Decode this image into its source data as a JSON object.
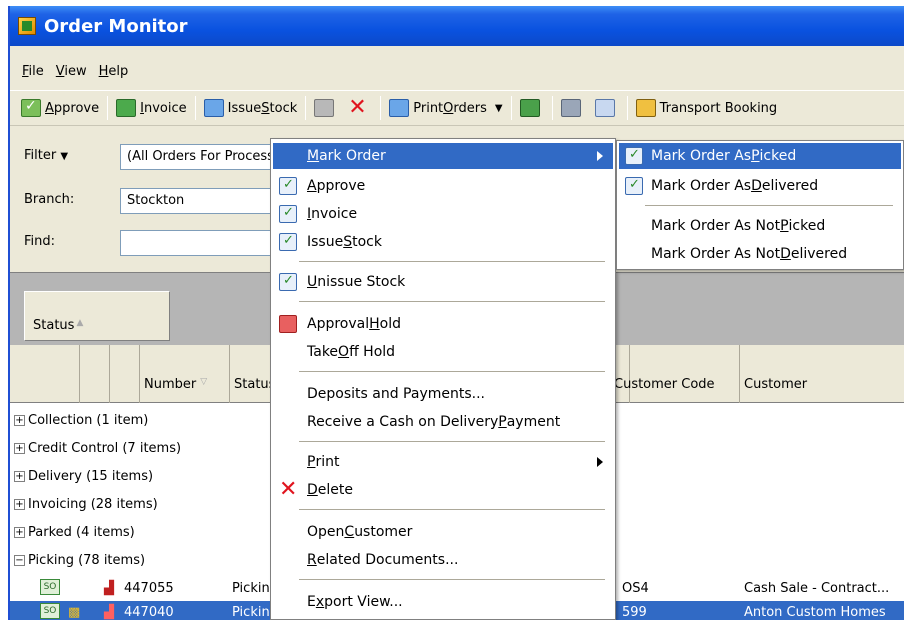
{
  "window": {
    "title": "Order Monitor"
  },
  "menubar": {
    "items": [
      {
        "pre": "",
        "u": "F",
        "post": "ile"
      },
      {
        "pre": "",
        "u": "V",
        "post": "iew"
      },
      {
        "pre": "",
        "u": "H",
        "post": "elp"
      }
    ]
  },
  "toolbar": {
    "approve": {
      "pre": "",
      "u": "A",
      "post": "pprove"
    },
    "invoice": {
      "pre": "",
      "u": "I",
      "post": "nvoice"
    },
    "issue_stock": {
      "pre": "Issue ",
      "u": "S",
      "post": "tock"
    },
    "print_orders": {
      "pre": "Print ",
      "u": "O",
      "post": "rders"
    },
    "transport_booking": "Transport Booking"
  },
  "filters": {
    "filter_label": "Filter",
    "filter_value": "(All Orders For Processing)",
    "branch_label": "Branch:",
    "branch_value": "Stockton",
    "find_label": "Find:",
    "find_value": ""
  },
  "grid": {
    "group_chip": "Status",
    "columns": {
      "number": "Number",
      "status": "Status",
      "customer_code": "Customer Code",
      "customer": "Customer"
    },
    "groups": [
      {
        "label": "Collection (1 item)",
        "expanded": false
      },
      {
        "label": "Credit Control (7 items)",
        "expanded": false
      },
      {
        "label": "Delivery (15 items)",
        "expanded": false
      },
      {
        "label": "Invoicing (28 items)",
        "expanded": false
      },
      {
        "label": "Parked (4 items)",
        "expanded": false
      },
      {
        "label": "Picking (78 items)",
        "expanded": true
      }
    ],
    "rows": [
      {
        "so": "SO",
        "number": "447055",
        "status": "Picking",
        "customer_code": "OS4",
        "customer": "Cash Sale - Contract...",
        "selected": false
      },
      {
        "so": "SO",
        "number": "447040",
        "status": "Picking",
        "customer_code": "599",
        "customer": "Anton Custom Homes",
        "selected": true
      }
    ]
  },
  "context_menu": {
    "items": [
      {
        "pre": "",
        "u": "M",
        "post": "ark Order",
        "submenu": true,
        "highlight": true,
        "icon": ""
      },
      {
        "pre": "",
        "u": "A",
        "post": "pprove",
        "icon": "check"
      },
      {
        "pre": "",
        "u": "I",
        "post": "nvoice",
        "icon": "check"
      },
      {
        "pre": "Issue ",
        "u": "S",
        "post": "tock",
        "icon": "check"
      },
      {
        "pre": "",
        "u": "U",
        "post": "nissue Stock",
        "icon": "check"
      },
      {
        "pre": "Approval ",
        "u": "H",
        "post": "old",
        "icon": "red"
      },
      {
        "pre": "Take ",
        "u": "O",
        "post": "ff Hold",
        "icon": ""
      },
      {
        "pre": "Deposits and Payments...",
        "u": "",
        "post": "",
        "icon": ""
      },
      {
        "pre": "Receive a Cash on Delivery ",
        "u": "P",
        "post": "ayment",
        "icon": ""
      },
      {
        "pre": "",
        "u": "P",
        "post": "rint",
        "submenu": true,
        "icon": ""
      },
      {
        "pre": "",
        "u": "D",
        "post": "elete",
        "icon": "delred"
      },
      {
        "pre": "Open ",
        "u": "C",
        "post": "ustomer",
        "icon": ""
      },
      {
        "pre": "",
        "u": "R",
        "post": "elated Documents...",
        "icon": ""
      },
      {
        "pre": "E",
        "u": "x",
        "post": "port View...",
        "icon": ""
      }
    ]
  },
  "submenu": {
    "items": [
      {
        "pre": "Mark Order As ",
        "u": "P",
        "post": "icked",
        "highlight": true,
        "icon": "check"
      },
      {
        "pre": "Mark Order As ",
        "u": "D",
        "post": "elivered",
        "icon": "check"
      },
      {
        "pre": "Mark Order As Not ",
        "u": "P",
        "post": "icked",
        "icon": ""
      },
      {
        "pre": "Mark Order As Not ",
        "u": "D",
        "post": "elivered",
        "icon": ""
      }
    ]
  }
}
